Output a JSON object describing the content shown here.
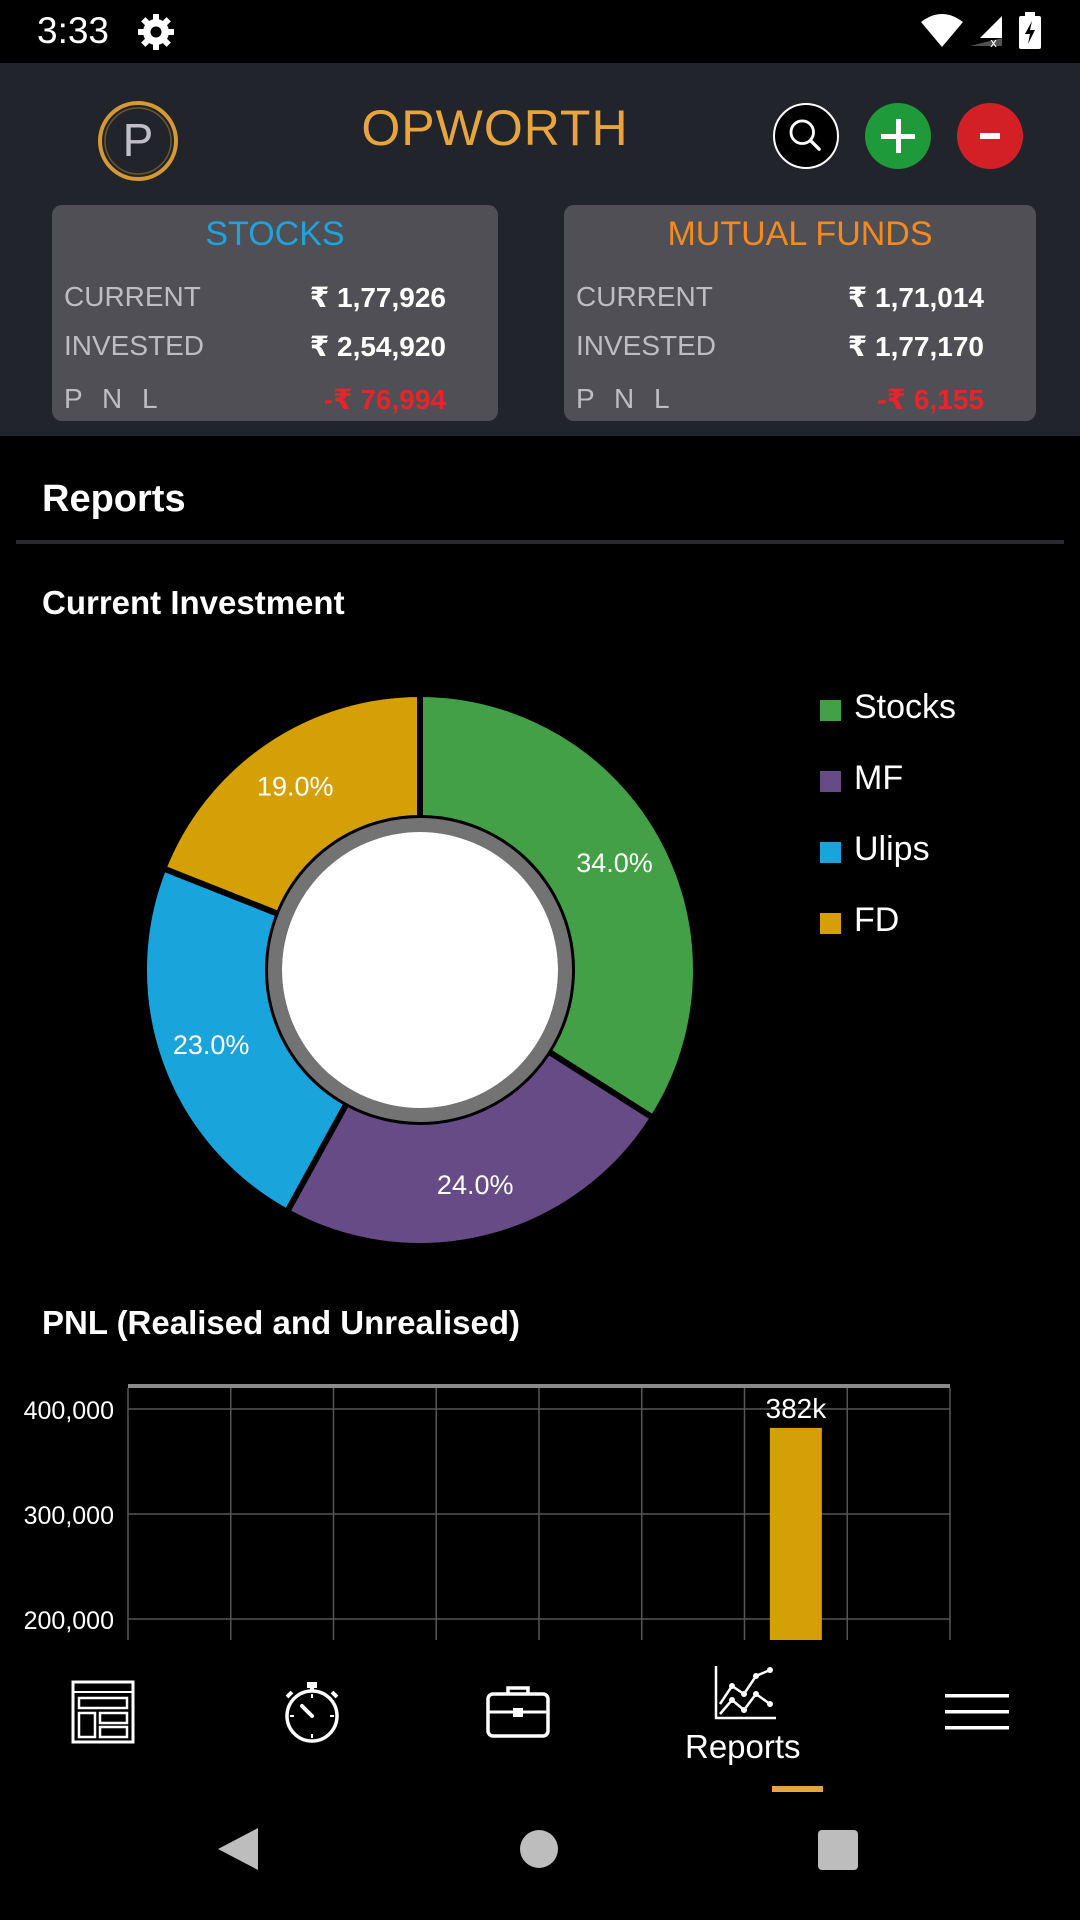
{
  "status_bar": {
    "time": "3:33",
    "icons": [
      "gear-icon",
      "wifi-icon",
      "signal-icon",
      "battery-icon"
    ]
  },
  "header": {
    "title": "OPWORTH",
    "logo_letter": "P",
    "buttons": [
      "search-icon",
      "plus-icon",
      "minus-icon"
    ],
    "colors": {
      "title": "#e8a53d",
      "add": "#1e9a3a",
      "remove": "#d32026",
      "background": "#22242b"
    }
  },
  "cards": {
    "stocks": {
      "title": "STOCKS",
      "current_label": "CURRENT",
      "current_value": "₹ 1,77,926",
      "invested_label": "INVESTED",
      "invested_value": "₹ 2,54,920",
      "pnl_label": "P N L",
      "pnl_value": "-₹ 76,994"
    },
    "mutual_funds": {
      "title": "MUTUAL FUNDS",
      "current_label": "CURRENT",
      "current_value": "₹ 1,71,014",
      "invested_label": "INVESTED",
      "invested_value": "₹ 1,77,170",
      "pnl_label": "P N L",
      "pnl_value": "-₹ 6,155"
    }
  },
  "reports": {
    "title": "Reports"
  },
  "chart_data": [
    {
      "type": "pie",
      "title": "Current Investment",
      "donut": true,
      "categories": [
        "Stocks",
        "MF",
        "Ulips",
        "FD"
      ],
      "values": [
        34.0,
        24.0,
        23.0,
        19.0
      ],
      "labels": [
        "34.0%",
        "24.0%",
        "23.0%",
        "19.0%"
      ],
      "colors": [
        "#43a047",
        "#674b87",
        "#19a5db",
        "#d4a005"
      ],
      "legend": "right"
    },
    {
      "type": "bar",
      "title": "PNL (Realised and Unrealised)",
      "y_ticks": [
        "400,000",
        "300,000",
        "200,000"
      ],
      "y_tick_values": [
        400000,
        300000,
        200000
      ],
      "ylim": [
        200000,
        420000
      ],
      "grid": true,
      "series": [
        {
          "values": [
            382000
          ],
          "labels": [
            "382k"
          ]
        }
      ],
      "bar_color": "#d4a005"
    }
  ],
  "bottom_nav": {
    "items": [
      {
        "icon": "dashboard-icon",
        "label": ""
      },
      {
        "icon": "stopwatch-icon",
        "label": ""
      },
      {
        "icon": "briefcase-icon",
        "label": ""
      },
      {
        "icon": "reports-chart-icon",
        "label": "Reports",
        "active": true
      },
      {
        "icon": "menu-icon",
        "label": ""
      }
    ],
    "active_color": "#e8a53d"
  },
  "system_nav": {
    "icons": [
      "back-icon",
      "home-icon",
      "recents-icon"
    ]
  }
}
